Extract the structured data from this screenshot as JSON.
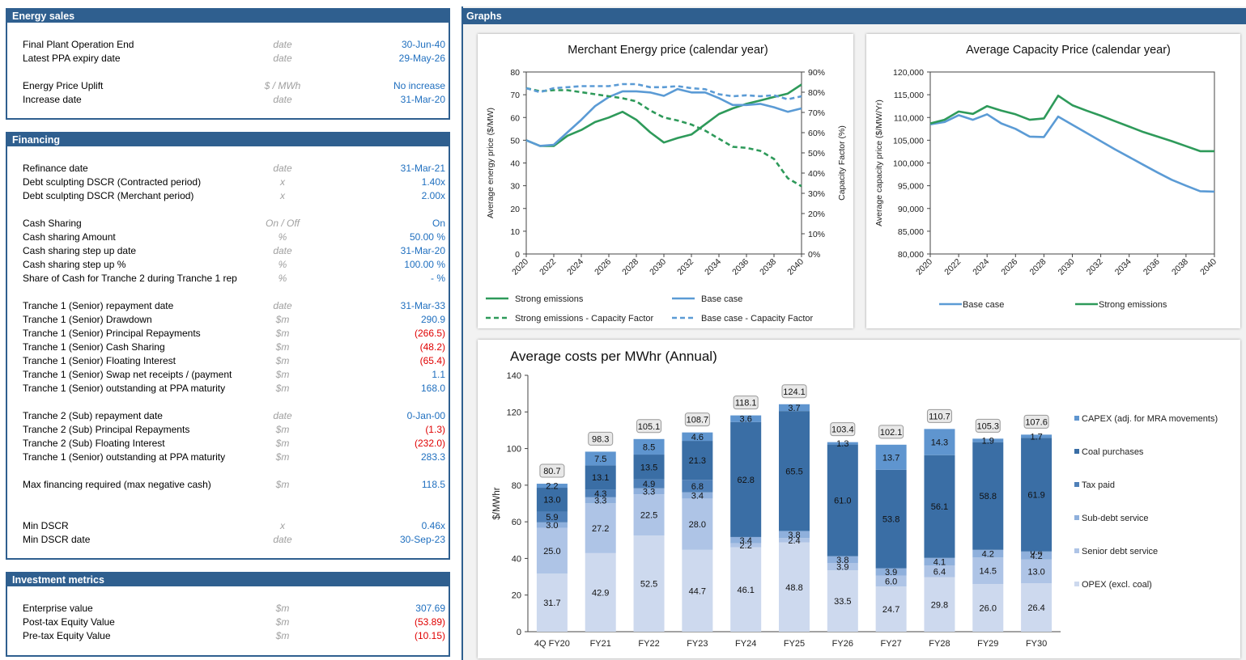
{
  "energy_sales": {
    "title": "Energy sales",
    "rows": [
      {
        "label": "Final Plant Operation End",
        "unit": "date",
        "value": "30-Jun-40",
        "neg": false
      },
      {
        "label": "Latest PPA expiry date",
        "unit": "date",
        "value": "29-May-26",
        "neg": false
      },
      {
        "label": "Energy Price Uplift",
        "unit": "$ / MWh",
        "value": "No increase",
        "neg": false
      },
      {
        "label": "Increase date",
        "unit": "date",
        "value": "31-Mar-20",
        "neg": false
      }
    ]
  },
  "financing": {
    "title": "Financing",
    "rows": [
      {
        "label": "Refinance date",
        "unit": "date",
        "value": "31-Mar-21",
        "neg": false
      },
      {
        "label": "Debt sculpting DSCR (Contracted period)",
        "unit": "x",
        "value": "1.40x",
        "neg": false
      },
      {
        "label": "Debt sculpting DSCR (Merchant period)",
        "unit": "x",
        "value": "2.00x",
        "neg": false
      },
      {
        "label": "Cash Sharing",
        "unit": "On / Off",
        "value": "On",
        "neg": false
      },
      {
        "label": "Cash sharing Amount",
        "unit": "%",
        "value": "50.00 %",
        "neg": false
      },
      {
        "label": "Cash sharing step up date",
        "unit": "date",
        "value": "31-Mar-20",
        "neg": false
      },
      {
        "label": "Cash sharing step up %",
        "unit": "%",
        "value": "100.00 %",
        "neg": false
      },
      {
        "label": "Share of Cash for Tranche 2 during Tranche 1 rep",
        "unit": "%",
        "value": "- %",
        "neg": false
      },
      {
        "label": "Tranche 1 (Senior) repayment date",
        "unit": "date",
        "value": "31-Mar-33",
        "neg": false
      },
      {
        "label": "Tranche 1 (Senior) Drawdown",
        "unit": "$m",
        "value": "290.9",
        "neg": false
      },
      {
        "label": "Tranche 1 (Senior) Principal Repayments",
        "unit": "$m",
        "value": "(266.5)",
        "neg": true
      },
      {
        "label": "Tranche 1 (Senior) Cash Sharing",
        "unit": "$m",
        "value": "(48.2)",
        "neg": true
      },
      {
        "label": "Tranche 1 (Senior) Floating Interest",
        "unit": "$m",
        "value": "(65.4)",
        "neg": true
      },
      {
        "label": "Tranche 1 (Senior) Swap net receipts / (payment",
        "unit": "$m",
        "value": "1.1",
        "neg": false
      },
      {
        "label": "Tranche 1 (Senior) outstanding at PPA maturity",
        "unit": "$m",
        "value": "168.0",
        "neg": false
      },
      {
        "label": "Tranche 2 (Sub) repayment date",
        "unit": "date",
        "value": "0-Jan-00",
        "neg": false
      },
      {
        "label": "Tranche 2 (Sub) Principal Repayments",
        "unit": "$m",
        "value": "(1.3)",
        "neg": true
      },
      {
        "label": "Tranche 2 (Sub) Floating Interest",
        "unit": "$m",
        "value": "(232.0)",
        "neg": true
      },
      {
        "label": "Tranche 1 (Senior) outstanding at PPA maturity",
        "unit": "$m",
        "value": "283.3",
        "neg": false
      },
      {
        "label": "Max financing required (max negative cash)",
        "unit": "$m",
        "value": "118.5",
        "neg": false
      },
      {
        "label": "Min DSCR",
        "unit": "x",
        "value": "0.46x",
        "neg": false
      },
      {
        "label": "Min DSCR date",
        "unit": "date",
        "value": "30-Sep-23",
        "neg": false
      }
    ]
  },
  "investment": {
    "title": "Investment metrics",
    "rows": [
      {
        "label": "Enterprise value",
        "unit": "$m",
        "value": "307.69",
        "neg": false
      },
      {
        "label": "Post-tax Equity Value",
        "unit": "$m",
        "value": "(53.89)",
        "neg": true
      },
      {
        "label": "Pre-tax Equity Value",
        "unit": "$m",
        "value": "(10.15)",
        "neg": true
      }
    ]
  },
  "graphs": {
    "title": "Graphs"
  },
  "colors": {
    "header": "#2f5f8f",
    "value": "#1f6fbf",
    "negative": "#e00000",
    "green": "#2e9a5a",
    "blue": "#5b9bd5"
  },
  "chart_data": [
    {
      "type": "line",
      "title": "Merchant Energy price (calendar year)",
      "ylabel": "Average energy price ($/MW)",
      "y2label": "Capacity Factor (%)",
      "x": [
        2020,
        2021,
        2022,
        2023,
        2024,
        2025,
        2026,
        2027,
        2028,
        2029,
        2030,
        2031,
        2032,
        2033,
        2034,
        2035,
        2036,
        2037,
        2038,
        2039,
        2040
      ],
      "xticks": [
        "2020",
        "2022",
        "2024",
        "2026",
        "2028",
        "2030",
        "2032",
        "2034",
        "2036",
        "2038",
        "2040"
      ],
      "ylim": [
        0,
        80
      ],
      "yticks": [
        "0",
        "10",
        "20",
        "30",
        "40",
        "50",
        "60",
        "70",
        "80"
      ],
      "y2lim": [
        0,
        90
      ],
      "y2ticks": [
        "0%",
        "10%",
        "20%",
        "30%",
        "40%",
        "50%",
        "60%",
        "70%",
        "80%",
        "90%"
      ],
      "series": [
        {
          "name": "Strong emissions",
          "axis": "left",
          "style": "solid",
          "color": "#2e9a5a",
          "values": [
            50,
            47.5,
            47.5,
            52,
            54.5,
            58,
            60,
            62.5,
            59,
            53.5,
            49,
            51,
            52.5,
            57,
            61.5,
            64,
            66,
            67.5,
            69,
            70.5,
            74.5
          ]
        },
        {
          "name": "Base case",
          "axis": "left",
          "style": "solid",
          "color": "#5b9bd5",
          "values": [
            50,
            47.5,
            48,
            53.5,
            59,
            65,
            69,
            71.5,
            71.5,
            71,
            69.5,
            72.5,
            71,
            71,
            68.5,
            65.5,
            65.5,
            66,
            64.5,
            62.5,
            64
          ]
        },
        {
          "name": "Strong emissions - Capacity Factor",
          "axis": "right",
          "style": "dashed",
          "color": "#2e9a5a",
          "values": [
            82,
            80.5,
            81,
            81,
            80,
            79,
            78,
            77,
            75.5,
            71,
            67.5,
            66,
            64,
            61,
            57,
            53,
            52.5,
            51,
            47,
            37.5,
            33.5
          ]
        },
        {
          "name": "Base case - Capacity Factor",
          "axis": "right",
          "style": "dashed",
          "color": "#5b9bd5",
          "values": [
            82,
            80,
            82,
            82.5,
            83,
            83,
            83,
            84,
            84,
            82.5,
            82.5,
            83,
            82,
            81.5,
            79,
            78,
            78.5,
            78,
            78.5,
            76.5,
            78
          ]
        }
      ]
    },
    {
      "type": "line",
      "title": "Average Capacity Price (calendar year)",
      "ylabel": "Average capacity price ($/MW/Yr)",
      "x": [
        2020,
        2021,
        2022,
        2023,
        2024,
        2025,
        2026,
        2027,
        2028,
        2029,
        2030,
        2031,
        2032,
        2033,
        2034,
        2035,
        2036,
        2037,
        2038,
        2039,
        2040
      ],
      "xticks": [
        "2020",
        "2022",
        "2024",
        "2026",
        "2028",
        "2030",
        "2032",
        "2034",
        "2036",
        "2038",
        "2040"
      ],
      "ylim": [
        80000,
        120000
      ],
      "yticks": [
        "80,000",
        "85,000",
        "90,000",
        "95,000",
        "100,000",
        "105,000",
        "110,000",
        "115,000",
        "120,000"
      ],
      "series": [
        {
          "name": "Base case",
          "color": "#5b9bd5",
          "values": [
            108500,
            109000,
            110500,
            109500,
            110700,
            108700,
            107500,
            105800,
            105700,
            110200,
            108400,
            106600,
            104800,
            103000,
            101300,
            99600,
            97900,
            96300,
            95000,
            93800,
            93700
          ]
        },
        {
          "name": "Strong emissions",
          "color": "#2e9a5a",
          "values": [
            108700,
            109500,
            111300,
            110800,
            112500,
            111500,
            110700,
            109500,
            109800,
            114800,
            112700,
            111500,
            110400,
            109200,
            108000,
            106800,
            105800,
            104800,
            103700,
            102600,
            102600
          ]
        }
      ]
    },
    {
      "type": "bar",
      "stacked": true,
      "title": "Average costs per MWhr (Annual)",
      "ylabel": "$/MWhr",
      "ylim": [
        0,
        140
      ],
      "yticks": [
        "0",
        "20",
        "40",
        "60",
        "80",
        "100",
        "120",
        "140"
      ],
      "categories": [
        "4Q FY20",
        "FY21",
        "FY22",
        "FY23",
        "FY24",
        "FY25",
        "FY26",
        "FY27",
        "FY28",
        "FY29",
        "FY30"
      ],
      "totals": [
        "80.7",
        "98.3",
        "105.1",
        "108.7",
        "118.1",
        "124.1",
        "103.4",
        "102.1",
        "110.7",
        "105.3",
        "107.6"
      ],
      "series": [
        {
          "name": "OPEX (excl. coal)",
          "color": "#cdd9ee",
          "values": [
            31.7,
            42.9,
            52.5,
            44.7,
            46.1,
            48.8,
            33.5,
            24.7,
            29.8,
            26.0,
            26.4
          ],
          "labels": [
            "31.7",
            "42.9",
            "52.5",
            "44.7",
            "46.1",
            "48.8",
            "33.5",
            "24.7",
            "29.8",
            "26.0",
            "26.4"
          ]
        },
        {
          "name": "Senior debt service",
          "color": "#aec4e6",
          "values": [
            25.0,
            27.2,
            22.5,
            28.0,
            2.2,
            2.4,
            3.9,
            6.0,
            6.4,
            14.5,
            13.0
          ],
          "labels": [
            "25.0",
            "27.2",
            "22.5",
            "28.0",
            "2.2",
            "2.4",
            "3.9",
            "6.0",
            "6.4",
            "14.5",
            "13.0"
          ]
        },
        {
          "name": "Sub-debt service",
          "color": "#8fb0dc",
          "values": [
            3.0,
            3.3,
            3.3,
            3.4,
            3.4,
            3.8,
            3.8,
            3.9,
            4.1,
            4.2,
            4.2
          ],
          "labels": [
            "3.0",
            "3.3",
            "3.3",
            "3.4",
            "3.4",
            "3.8",
            "3.8",
            "3.9",
            "4.1",
            "4.2",
            "4.2"
          ]
        },
        {
          "name": "Tax paid",
          "color": "#4f80b8",
          "values": [
            5.9,
            4.3,
            4.9,
            6.8,
            0,
            0,
            0,
            0,
            0,
            0,
            0.4
          ],
          "labels": [
            "5.9",
            "4.3",
            "4.9",
            "6.8",
            "",
            "",
            "",
            "",
            "",
            "",
            "0.4"
          ]
        },
        {
          "name": "Coal purchases",
          "color": "#3a6ea5",
          "values": [
            13.0,
            13.1,
            13.5,
            21.3,
            62.8,
            65.5,
            61.0,
            53.8,
            56.1,
            58.8,
            61.9
          ],
          "labels": [
            "13.0",
            "13.1",
            "13.5",
            "21.3",
            "62.8",
            "65.5",
            "61.0",
            "53.8",
            "56.1",
            "58.8",
            "61.9"
          ]
        },
        {
          "name": "CAPEX (adj. for MRA movements)",
          "color": "#5f95cf",
          "values": [
            2.2,
            7.5,
            8.5,
            4.6,
            3.6,
            3.7,
            1.3,
            13.7,
            14.3,
            1.9,
            1.7
          ],
          "labels": [
            "2.2",
            "7.5",
            "8.5",
            "4.6",
            "3.6",
            "3.7",
            "1.3",
            "13.7",
            "14.3",
            "1.9",
            "1.7"
          ]
        }
      ]
    }
  ]
}
